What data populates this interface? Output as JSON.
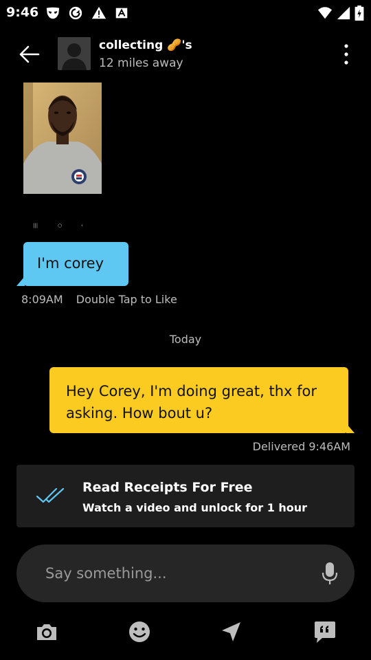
{
  "status_bar": {
    "time": "9:46",
    "notification_icons": [
      "grindr-mask-icon",
      "sync-icon",
      "warning-icon",
      "a-badge-icon"
    ],
    "system_icons": [
      "wifi-icon",
      "signal-icon",
      "battery-icon"
    ]
  },
  "header": {
    "back_icon": "arrow-left-icon",
    "name": "collecting 🥜's",
    "subtitle": "12 miles away",
    "more_icon": "more-vertical-icon"
  },
  "messages": {
    "incoming": {
      "text": "I'm corey",
      "time": "8:09AM",
      "like_hint": "Double Tap to Like",
      "color": "#5fc8f2"
    },
    "day_separator": "Today",
    "outgoing": {
      "text": "Hey Corey, I'm doing great, thx for asking. How bout u?",
      "status": "Delivered 9:46AM",
      "color": "#fccb21"
    }
  },
  "read_receipts": {
    "icon": "double-check-icon",
    "title": "Read Receipts For Free",
    "subtitle": "Watch a video and unlock for 1 hour",
    "accent": "#5fc8f2"
  },
  "composer": {
    "placeholder": "Say something...",
    "value": "",
    "mic_icon": "microphone-icon"
  },
  "toolbar": {
    "items": [
      "camera-icon",
      "emoji-icon",
      "location-icon",
      "saved-phrases-icon"
    ]
  }
}
